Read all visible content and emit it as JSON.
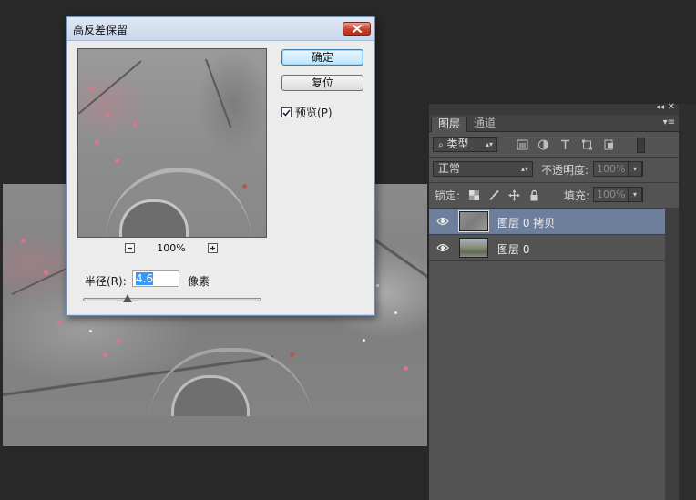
{
  "dialog": {
    "title": "高反差保留",
    "ok_label": "确定",
    "reset_label": "复位",
    "preview_label": "预览(P)",
    "preview_checked": true,
    "zoom_level": "100%",
    "radius_label": "半径(R):",
    "radius_value": "4.6",
    "radius_unit": "像素",
    "radius_slider_fraction": 0.25
  },
  "layers_panel": {
    "tabs": [
      {
        "label": "图层",
        "active": true
      },
      {
        "label": "通道",
        "active": false
      }
    ],
    "filter_kind": "类型",
    "blend_mode": "正常",
    "opacity_label": "不透明度:",
    "opacity_value": "100%",
    "lock_label": "锁定:",
    "fill_label": "填充:",
    "fill_value": "100%",
    "layers": [
      {
        "name": "图层 0 拷贝",
        "selected": true,
        "visible": true
      },
      {
        "name": "图层 0",
        "selected": false,
        "visible": true
      }
    ]
  },
  "colors": {
    "workspace_bg": "#282828",
    "panel_bg": "#535353",
    "selected_layer": "#6d7f9b",
    "close_button": "#c8402c"
  }
}
